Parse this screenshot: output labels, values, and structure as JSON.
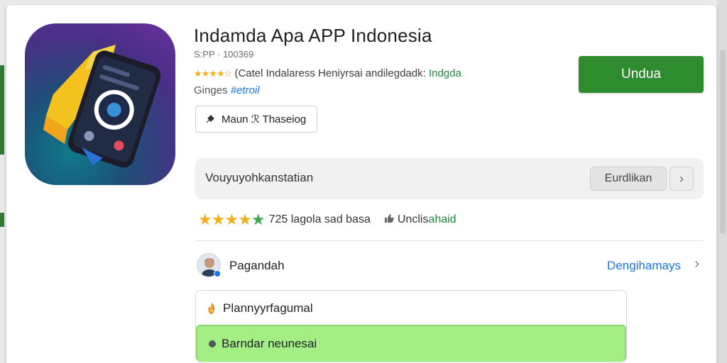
{
  "app": {
    "title": "Indamda Apa APP Indonesia",
    "subtitle": "S:PP · 100369",
    "rating_stars": "★★★★☆",
    "rating_text": "(Catel Indalaress Heniyrsai andilegdadk:",
    "rating_tag": "Indgda",
    "category_prefix": "Ginges",
    "category_link": "#etroil"
  },
  "buttons": {
    "wishlist_label": "Maun ℛ Thaseiog",
    "install_label": "Undua"
  },
  "info_bar": {
    "text": "Vouyuyohkanstatian",
    "button_label": "Eurdlikan",
    "next_glyph": "›"
  },
  "stats": {
    "stars": "★★★★",
    "last_star": "★",
    "rating_value": 4.5,
    "reviews": "725  lagola sad basa",
    "verified_prefix": "Unclis",
    "verified_highlight": "ahaid"
  },
  "developer": {
    "name": "Pagandah",
    "link_label": "Dengihamays",
    "chevron": "›"
  },
  "options": [
    {
      "label": "Plannyyrfagumal",
      "selected": false
    },
    {
      "label": "Barndar neunesai",
      "selected": true
    }
  ],
  "colors": {
    "install": "#2e8b2e",
    "link": "#1a73e8",
    "star": "#f2b01e",
    "selected_option": "#a4ee86"
  },
  "icons": {
    "app_icon": "phone-app-icon",
    "pin": "pin-icon",
    "thumb": "thumb-icon",
    "option1": "flame-icon",
    "option2": "dot-icon"
  }
}
